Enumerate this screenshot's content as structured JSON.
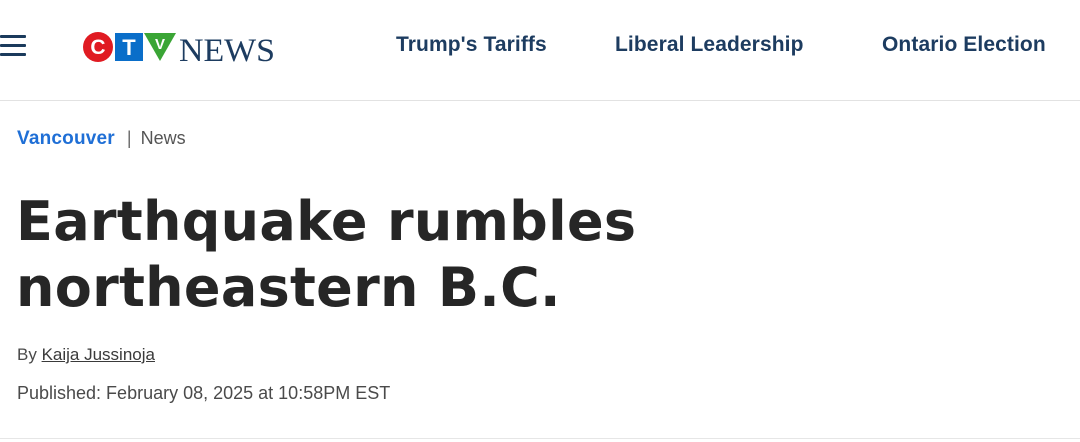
{
  "header": {
    "menu_icon": "hamburger-menu-icon",
    "logo": {
      "letters": [
        "C",
        "T",
        "V"
      ],
      "wordmark": "NEWS",
      "colors": {
        "c_red": "#e01b22",
        "t_blue": "#0a6ec9",
        "v_green": "#3aa535",
        "wordmark": "#1d3c60"
      }
    },
    "nav": [
      {
        "label": "Trump's Tariffs"
      },
      {
        "label": "Liberal Leadership"
      },
      {
        "label": "Ontario Election"
      }
    ]
  },
  "breadcrumb": {
    "section": "Vancouver",
    "separator": "|",
    "subsection": "News"
  },
  "article": {
    "headline": "Earthquake rumbles northeastern B.C.",
    "byline_prefix": "By",
    "author": "Kaija Jussinoja",
    "published": "Published: February 08, 2025 at 10:58PM EST"
  },
  "colors": {
    "nav_text": "#1d3c60",
    "breadcrumb_link": "#1f6fd6",
    "headline": "#262626",
    "divider": "#e2e2e2"
  }
}
